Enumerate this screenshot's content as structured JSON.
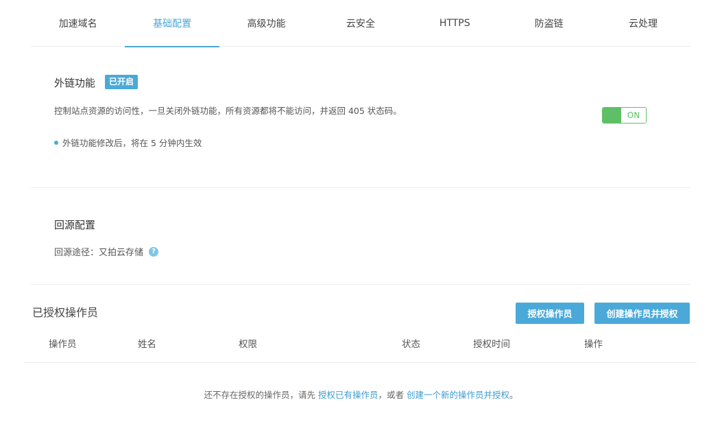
{
  "tabs": [
    {
      "label": "加速域名"
    },
    {
      "label": "基础配置"
    },
    {
      "label": "高级功能"
    },
    {
      "label": "云安全"
    },
    {
      "label": "HTTPS"
    },
    {
      "label": "防盗链"
    },
    {
      "label": "云处理"
    }
  ],
  "active_tab": "基础配置",
  "hotlink": {
    "title": "外链功能",
    "badge": "已开启",
    "description": "控制站点资源的访问性，一旦关闭外链功能，所有资源都将不能访问，并返回 405 状态码。",
    "note": "外链功能修改后，将在 5 分钟内生效",
    "toggle_label": "ON"
  },
  "origin": {
    "title": "回源配置",
    "path": "回源途径：又拍云存储",
    "help_glyph": "?"
  },
  "operators": {
    "title": "已授权操作员",
    "authorize_button": "授权操作员",
    "create_button": "创建操作员并授权",
    "columns": [
      "操作员",
      "姓名",
      "权限",
      "状态",
      "授权时间",
      "操作"
    ],
    "empty_prefix": "还不存在授权的操作员，请先 ",
    "empty_link1": "授权已有操作员",
    "empty_middle": "，或者 ",
    "empty_link2": "创建一个新的操作员并授权",
    "empty_suffix": "。"
  },
  "colors": {
    "accent": "#4aa9d8",
    "toggle_on": "#5fbf67"
  }
}
